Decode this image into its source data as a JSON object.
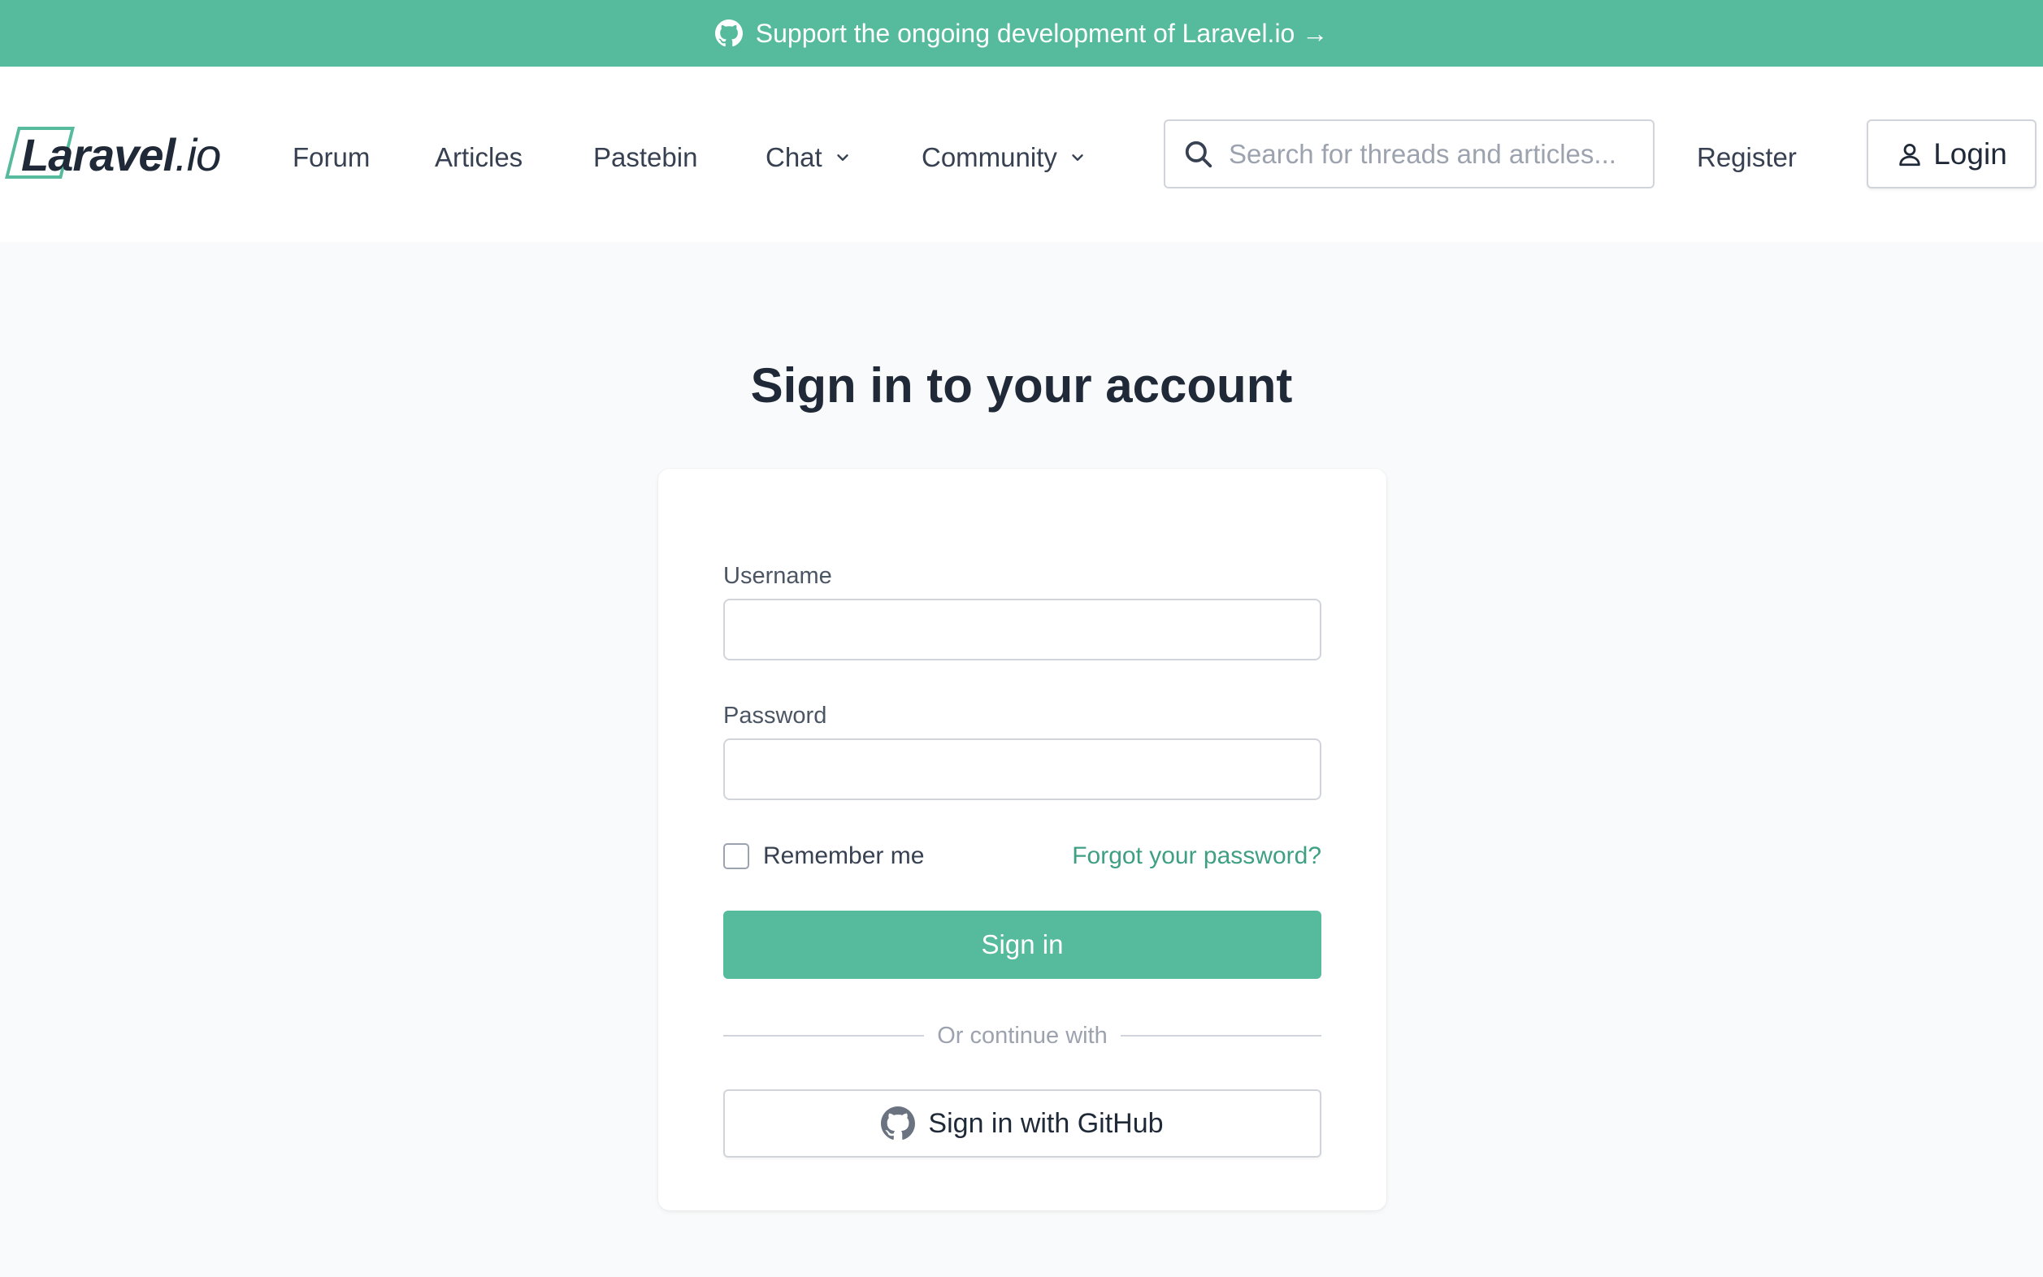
{
  "banner": {
    "text": "Support the ongoing development of Laravel.io →",
    "icon": "github-icon",
    "background": "#56ba9c"
  },
  "header": {
    "logo": {
      "bold": "Laravel",
      "light": ".io"
    },
    "nav": [
      {
        "label": "Forum"
      },
      {
        "label": "Articles"
      },
      {
        "label": "Pastebin"
      },
      {
        "label": "Chat",
        "dropdown": true
      },
      {
        "label": "Community",
        "dropdown": true
      }
    ],
    "search": {
      "placeholder": "Search for threads and articles...",
      "value": ""
    },
    "register_label": "Register",
    "login_label": "Login"
  },
  "main": {
    "title": "Sign in to your account",
    "username_label": "Username",
    "username_value": "",
    "password_label": "Password",
    "password_value": "",
    "remember_label": "Remember me",
    "remember_checked": false,
    "forgot_label": "Forgot your password?",
    "signin_label": "Sign in",
    "divider_text": "Or continue with",
    "github_label": "Sign in with GitHub"
  },
  "colors": {
    "accent": "#56ba9c",
    "link": "#3f9f84",
    "page_bg": "#f9fafb"
  }
}
